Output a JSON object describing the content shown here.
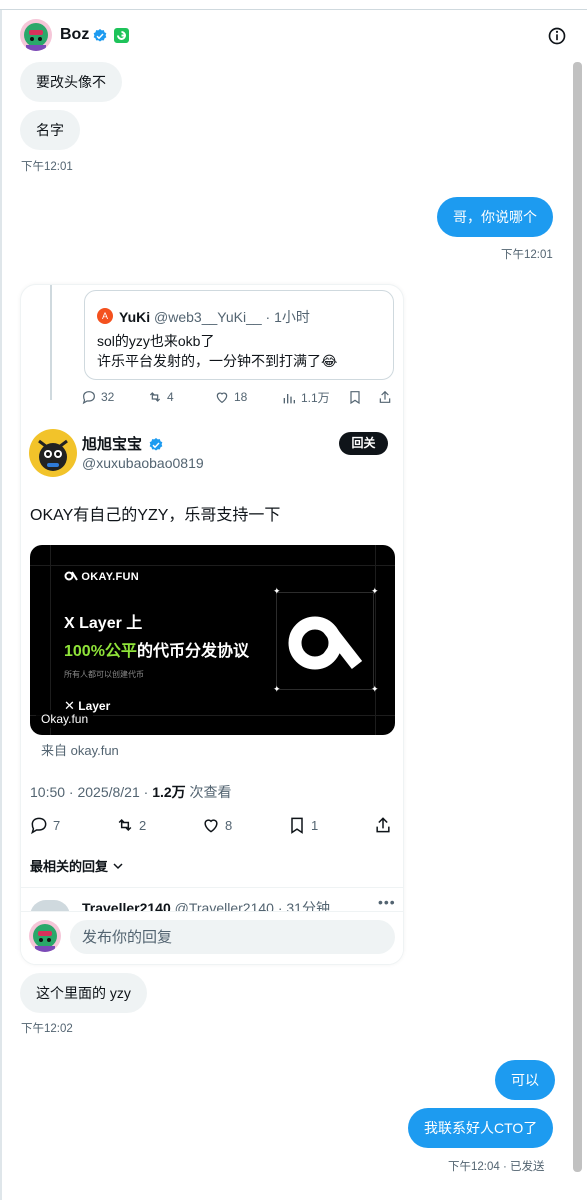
{
  "header": {
    "name": "Boz"
  },
  "messages": {
    "m1": "要改头像不",
    "m2": "名字",
    "t1": "下午12:01",
    "m3": "哥，你说哪个",
    "t2": "下午12:01",
    "m4": "这个里面的 yzy",
    "t3": "下午12:02",
    "m5": "可以",
    "m6": "我联系好人CTO了",
    "t4": "下午12:04 · 已发送"
  },
  "embed": {
    "quote": {
      "avatar_letter": "A",
      "name": "YuKi",
      "handle": "@web3__YuKi__ · 1小时",
      "line1": "sol的yzy也来okb了",
      "line2": "许乐平台发射的，一分钟不到打满了😂"
    },
    "quote_actions": {
      "replies": "32",
      "reposts": "4",
      "likes": "18",
      "views": "1.1万"
    },
    "tweet": {
      "name": "旭旭宝宝",
      "handle": "@xuxubaobao0819",
      "follow_label": "回关",
      "text": "OKAY有自己的YZY，乐哥支持一下"
    },
    "media": {
      "brand": "OKAY.FUN",
      "headline1": "X Layer 上",
      "headline2_highlight": "100%公平",
      "headline2_rest": "的代币分发协议",
      "small_text": "所有人都可以创建代币",
      "footer_brand": "Layer",
      "tag": "Okay.fun"
    },
    "from": "来自 okay.fun",
    "meta": {
      "time": "10:50 · 2025/8/21 · ",
      "views": "1.2万",
      "views_suffix": " 次查看"
    },
    "actions": {
      "replies": "7",
      "reposts": "2",
      "likes": "8",
      "bookmarks": "1"
    },
    "sort_label": "最相关的回复",
    "reply": {
      "name": "Traveller2140",
      "handle": "@Traveller2140 · 31分钟"
    },
    "compose_placeholder": "发布你的回复"
  },
  "colors": {
    "accent": "#1d9bf0",
    "bubble_in": "#eff3f4",
    "highlight": "#8fe339"
  }
}
